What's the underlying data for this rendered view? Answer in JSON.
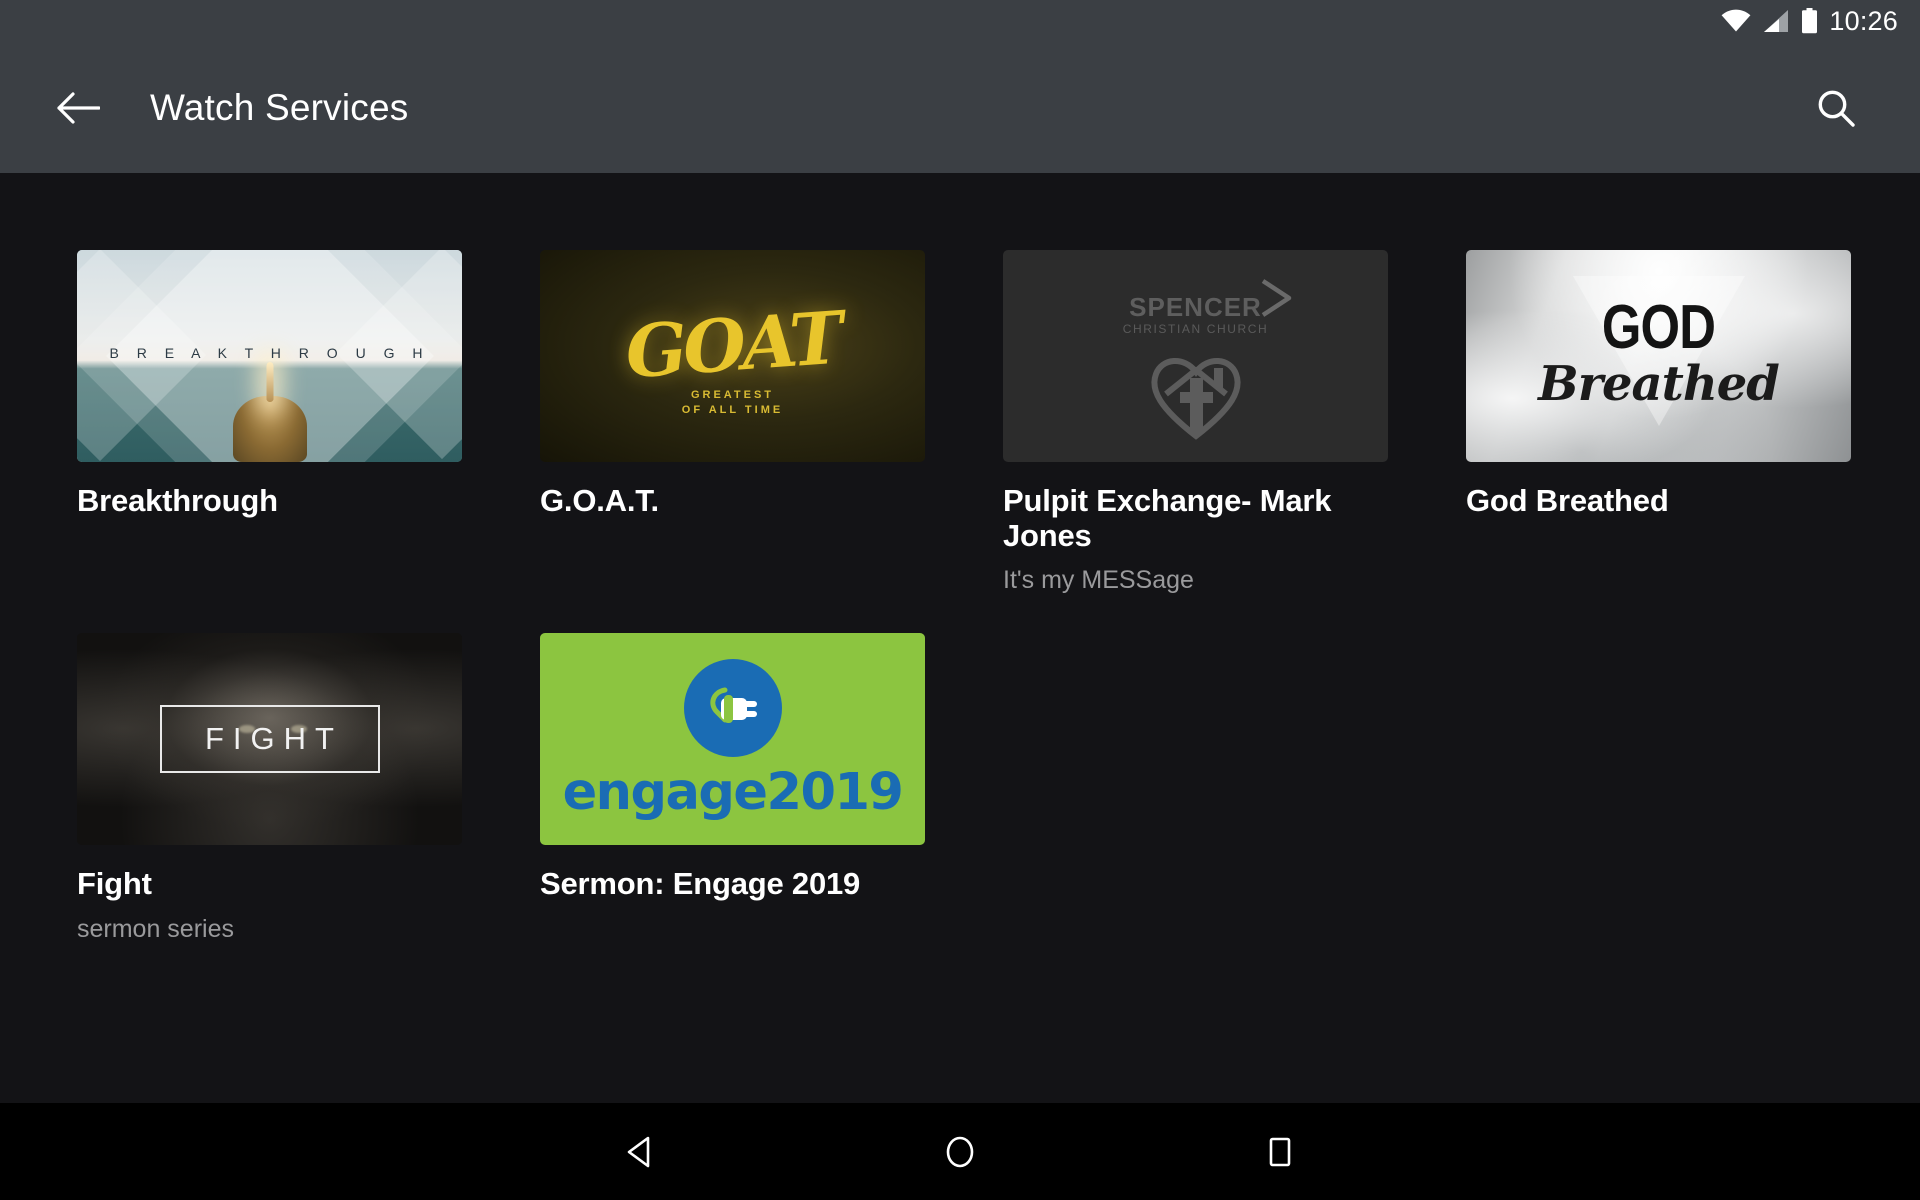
{
  "status_bar": {
    "time": "10:26",
    "icons": [
      "wifi-icon",
      "cellular-signal-icon",
      "battery-icon"
    ]
  },
  "toolbar": {
    "back_icon": "arrow-back-icon",
    "title": "Watch Services",
    "search_icon": "search-icon"
  },
  "nav_bar": {
    "back_label": "back-triangle-icon",
    "home_label": "home-circle-icon",
    "recents_label": "recents-square-icon"
  },
  "grid": {
    "items": [
      {
        "title": "Breakthrough",
        "subtitle": "",
        "thumb_name": "breakthrough-thumbnail",
        "thumb_text": "B R E A K   T H R O U G H"
      },
      {
        "title": "G.O.A.T.",
        "subtitle": "",
        "thumb_name": "goat-thumbnail",
        "thumb_text": "GOAT",
        "thumb_subtext": "GREATEST\nOF ALL TIME"
      },
      {
        "title": "Pulpit Exchange- Mark Jones",
        "subtitle": "It's my MESSage",
        "thumb_name": "pulpit-exchange-thumbnail",
        "thumb_text": "SPENCER",
        "thumb_subtext": "CHRISTIAN CHURCH"
      },
      {
        "title": "God Breathed",
        "subtitle": "",
        "thumb_name": "god-breathed-thumbnail",
        "thumb_text": "GOD",
        "thumb_subtext": "Breathed"
      },
      {
        "title": "Fight",
        "subtitle": "sermon series",
        "thumb_name": "fight-thumbnail",
        "thumb_text": "FIGHT"
      },
      {
        "title": "Sermon: Engage 2019",
        "subtitle": "",
        "thumb_name": "engage-2019-thumbnail",
        "thumb_text": "engage2019"
      }
    ]
  },
  "colors": {
    "toolbar_bg": "#3b3f44",
    "content_bg": "#131316",
    "navbar_bg": "#000000",
    "title_text": "#ffffff",
    "subtitle_text": "#9a9a9c",
    "engage_green": "#8cc540",
    "engage_blue": "#1a6cb4",
    "goat_yellow": "#e8c52c"
  }
}
